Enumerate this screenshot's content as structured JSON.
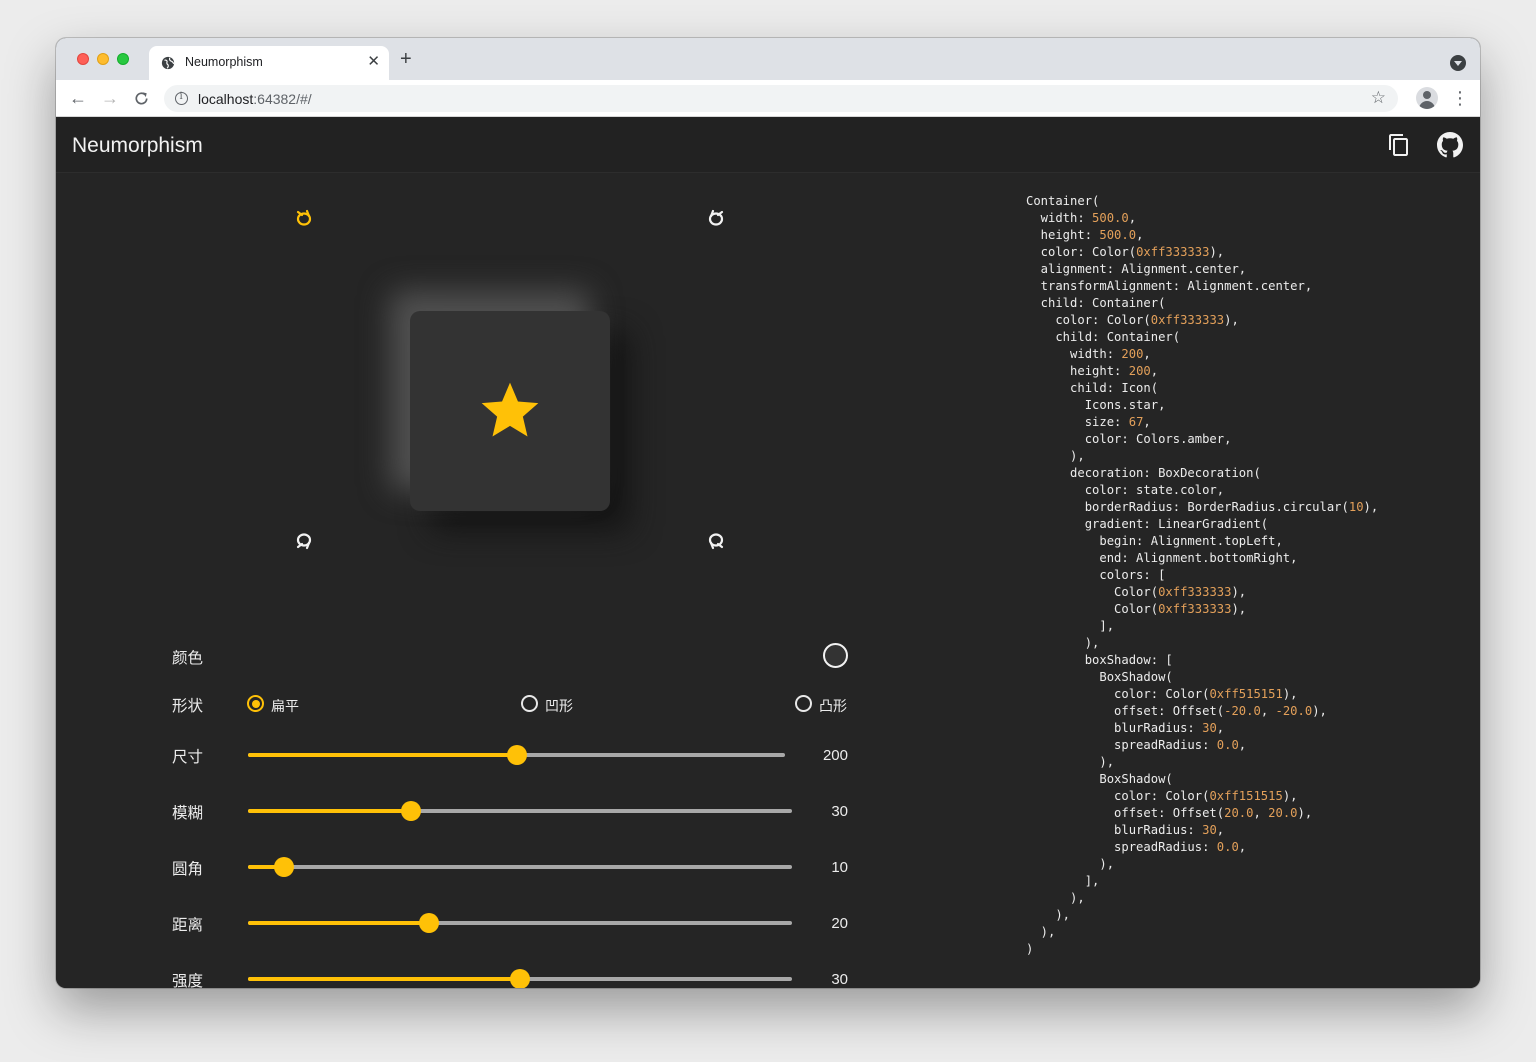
{
  "browser": {
    "tab_title": "Neumorphism",
    "new_tab_label": "+",
    "url_host": "localhost",
    "url_rest": ":64382/#/"
  },
  "app": {
    "title": "Neumorphism"
  },
  "colors": {
    "accent": "#ffc107",
    "surface": "#333333",
    "light_shadow": "#515151",
    "dark_shadow": "#151515",
    "background": "#252525"
  },
  "light_source_buttons": [
    {
      "name": "top-left",
      "selected": true
    },
    {
      "name": "top-right",
      "selected": false
    },
    {
      "name": "bottom-left",
      "selected": false
    },
    {
      "name": "bottom-right",
      "selected": false
    }
  ],
  "preview": {
    "icon": "star-icon",
    "icon_color": "#ffc107"
  },
  "controls": {
    "color": {
      "label": "颜色"
    },
    "shape": {
      "label": "形状",
      "options": [
        "扁平",
        "凹形",
        "凸形"
      ],
      "selected": "扁平"
    },
    "sliders": [
      {
        "label": "尺寸",
        "value": "200",
        "fraction": 0.5
      },
      {
        "label": "模糊",
        "value": "30",
        "fraction": 0.3
      },
      {
        "label": "圆角",
        "value": "10",
        "fraction": 0.066
      },
      {
        "label": "距离",
        "value": "20",
        "fraction": 0.333
      },
      {
        "label": "强度",
        "value": "30",
        "fraction": 0.5
      }
    ]
  },
  "code_lines": [
    [
      [
        "Container(",
        false
      ]
    ],
    [
      [
        "  width: ",
        false
      ],
      [
        "500.0",
        true
      ],
      [
        ",",
        false
      ]
    ],
    [
      [
        "  height: ",
        false
      ],
      [
        "500.0",
        true
      ],
      [
        ",",
        false
      ]
    ],
    [
      [
        "  color: Color(",
        false
      ],
      [
        "0xff333333",
        true
      ],
      [
        "),",
        false
      ]
    ],
    [
      [
        "  alignment: Alignment.center,",
        false
      ]
    ],
    [
      [
        "  transformAlignment: Alignment.center,",
        false
      ]
    ],
    [
      [
        "  child: Container(",
        false
      ]
    ],
    [
      [
        "    color: Color(",
        false
      ],
      [
        "0xff333333",
        true
      ],
      [
        "),",
        false
      ]
    ],
    [
      [
        "    child: Container(",
        false
      ]
    ],
    [
      [
        "      width: ",
        false
      ],
      [
        "200",
        true
      ],
      [
        ",",
        false
      ]
    ],
    [
      [
        "      height: ",
        false
      ],
      [
        "200",
        true
      ],
      [
        ",",
        false
      ]
    ],
    [
      [
        "      child: Icon(",
        false
      ]
    ],
    [
      [
        "        Icons.star,",
        false
      ]
    ],
    [
      [
        "        size: ",
        false
      ],
      [
        "67",
        true
      ],
      [
        ",",
        false
      ]
    ],
    [
      [
        "        color: Colors.amber,",
        false
      ]
    ],
    [
      [
        "      ),",
        false
      ]
    ],
    [
      [
        "      decoration: BoxDecoration(",
        false
      ]
    ],
    [
      [
        "        color: state.color,",
        false
      ]
    ],
    [
      [
        "        borderRadius: BorderRadius.circular(",
        false
      ],
      [
        "10",
        true
      ],
      [
        "),",
        false
      ]
    ],
    [
      [
        "        gradient: LinearGradient(",
        false
      ]
    ],
    [
      [
        "          begin: Alignment.topLeft,",
        false
      ]
    ],
    [
      [
        "          end: Alignment.bottomRight,",
        false
      ]
    ],
    [
      [
        "          colors: [",
        false
      ]
    ],
    [
      [
        "            Color(",
        false
      ],
      [
        "0xff333333",
        true
      ],
      [
        "),",
        false
      ]
    ],
    [
      [
        "            Color(",
        false
      ],
      [
        "0xff333333",
        true
      ],
      [
        "),",
        false
      ]
    ],
    [
      [
        "          ],",
        false
      ]
    ],
    [
      [
        "        ),",
        false
      ]
    ],
    [
      [
        "        boxShadow: [",
        false
      ]
    ],
    [
      [
        "          BoxShadow(",
        false
      ]
    ],
    [
      [
        "            color: Color(",
        false
      ],
      [
        "0xff515151",
        true
      ],
      [
        "),",
        false
      ]
    ],
    [
      [
        "            offset: Offset(",
        false
      ],
      [
        "-20.0",
        true
      ],
      [
        ", ",
        false
      ],
      [
        "-20.0",
        true
      ],
      [
        "),",
        false
      ]
    ],
    [
      [
        "            blurRadius: ",
        false
      ],
      [
        "30",
        true
      ],
      [
        ",",
        false
      ]
    ],
    [
      [
        "            spreadRadius: ",
        false
      ],
      [
        "0.0",
        true
      ],
      [
        ",",
        false
      ]
    ],
    [
      [
        "          ),",
        false
      ]
    ],
    [
      [
        "          BoxShadow(",
        false
      ]
    ],
    [
      [
        "            color: Color(",
        false
      ],
      [
        "0xff151515",
        true
      ],
      [
        "),",
        false
      ]
    ],
    [
      [
        "            offset: Offset(",
        false
      ],
      [
        "20.0",
        true
      ],
      [
        ", ",
        false
      ],
      [
        "20.0",
        true
      ],
      [
        "),",
        false
      ]
    ],
    [
      [
        "            blurRadius: ",
        false
      ],
      [
        "30",
        true
      ],
      [
        ",",
        false
      ]
    ],
    [
      [
        "            spreadRadius: ",
        false
      ],
      [
        "0.0",
        true
      ],
      [
        ",",
        false
      ]
    ],
    [
      [
        "          ),",
        false
      ]
    ],
    [
      [
        "        ],",
        false
      ]
    ],
    [
      [
        "      ),",
        false
      ]
    ],
    [
      [
        "    ),",
        false
      ]
    ],
    [
      [
        "  ),",
        false
      ]
    ],
    [
      [
        ")",
        false
      ]
    ]
  ]
}
